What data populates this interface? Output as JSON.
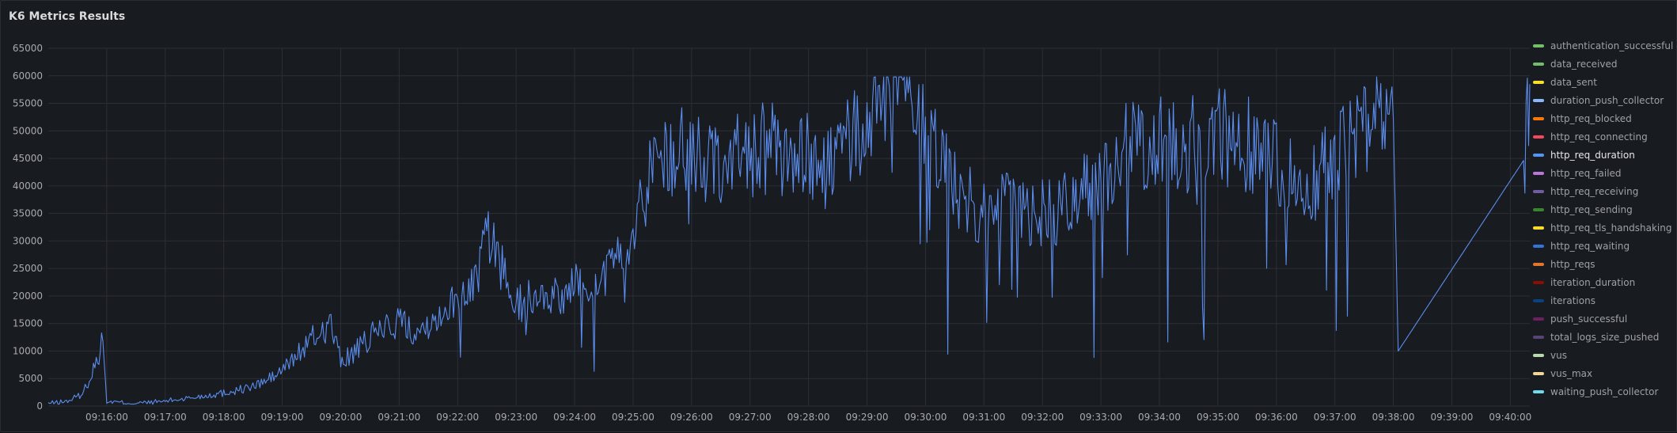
{
  "panel": {
    "title": "K6 Metrics Results"
  },
  "chart_data": {
    "type": "line",
    "title": "K6 Metrics Results",
    "ylim": [
      0,
      65000
    ],
    "y_ticks": [
      "0",
      "5000",
      "10000",
      "15000",
      "20000",
      "25000",
      "30000",
      "35000",
      "40000",
      "45000",
      "50000",
      "55000",
      "60000",
      "65000"
    ],
    "x_range": [
      "09:15:00",
      "09:40:20"
    ],
    "x_ticks": [
      "09:16:00",
      "09:17:00",
      "09:18:00",
      "09:19:00",
      "09:20:00",
      "09:21:00",
      "09:22:00",
      "09:23:00",
      "09:24:00",
      "09:25:00",
      "09:26:00",
      "09:27:00",
      "09:28:00",
      "09:29:00",
      "09:30:00",
      "09:31:00",
      "09:32:00",
      "09:33:00",
      "09:34:00",
      "09:35:00",
      "09:36:00",
      "09:37:00",
      "09:38:00",
      "09:39:00",
      "09:40:00"
    ],
    "grid": true,
    "legend_position": "right",
    "series": [
      {
        "name": "http_req_duration",
        "color": "#5b8def",
        "points": [
          [
            "09:15:00",
            500
          ],
          [
            "09:15:20",
            900
          ],
          [
            "09:15:35",
            2200
          ],
          [
            "09:15:45",
            6000
          ],
          [
            "09:15:52",
            9500
          ],
          [
            "09:15:56",
            11800
          ],
          [
            "09:16:00",
            800
          ],
          [
            "09:16:30",
            500
          ],
          [
            "09:17:00",
            900
          ],
          [
            "09:17:30",
            1600
          ],
          [
            "09:18:00",
            2400
          ],
          [
            "09:18:30",
            3500
          ],
          [
            "09:18:50",
            5200
          ],
          [
            "09:19:00",
            6500
          ],
          [
            "09:19:30",
            12000
          ],
          [
            "09:19:50",
            15000
          ],
          [
            "09:20:00",
            8000
          ],
          [
            "09:20:20",
            10500
          ],
          [
            "09:20:40",
            14000
          ],
          [
            "09:21:00",
            15500
          ],
          [
            "09:21:20",
            13500
          ],
          [
            "09:21:40",
            17000
          ],
          [
            "09:22:00",
            19500
          ],
          [
            "09:22:20",
            23500
          ],
          [
            "09:22:30",
            31000
          ],
          [
            "09:22:40",
            28000
          ],
          [
            "09:23:00",
            18000
          ],
          [
            "09:23:20",
            21000
          ],
          [
            "09:23:40",
            19500
          ],
          [
            "09:24:00",
            22000
          ],
          [
            "09:24:20",
            23000
          ],
          [
            "09:24:40",
            24500
          ],
          [
            "09:25:00",
            32000
          ],
          [
            "09:25:20",
            44000
          ],
          [
            "09:25:40",
            46500
          ],
          [
            "09:26:00",
            45000
          ],
          [
            "09:26:20",
            45500
          ],
          [
            "09:26:40",
            44000
          ],
          [
            "09:27:00",
            46500
          ],
          [
            "09:27:20",
            47000
          ],
          [
            "09:27:40",
            44500
          ],
          [
            "09:28:00",
            45000
          ],
          [
            "09:28:20",
            43000
          ],
          [
            "09:28:40",
            47000
          ],
          [
            "09:29:00",
            52000
          ],
          [
            "09:29:20",
            56000
          ],
          [
            "09:29:30",
            59500
          ],
          [
            "09:29:45",
            59800
          ],
          [
            "09:30:00",
            52000
          ],
          [
            "09:30:20",
            44000
          ],
          [
            "09:30:40",
            37000
          ],
          [
            "09:31:00",
            36500
          ],
          [
            "09:31:20",
            37500
          ],
          [
            "09:31:40",
            34500
          ],
          [
            "09:32:00",
            35000
          ],
          [
            "09:32:20",
            35500
          ],
          [
            "09:32:40",
            38500
          ],
          [
            "09:33:00",
            42000
          ],
          [
            "09:33:20",
            46000
          ],
          [
            "09:33:40",
            47500
          ],
          [
            "09:34:00",
            48500
          ],
          [
            "09:34:20",
            47000
          ],
          [
            "09:34:40",
            48000
          ],
          [
            "09:35:00",
            49000
          ],
          [
            "09:35:20",
            48500
          ],
          [
            "09:35:40",
            46500
          ],
          [
            "09:36:00",
            44000
          ],
          [
            "09:36:20",
            42500
          ],
          [
            "09:36:40",
            41500
          ],
          [
            "09:37:00",
            45000
          ],
          [
            "09:37:20",
            49000
          ],
          [
            "09:37:40",
            51000
          ],
          [
            "09:38:00",
            52000
          ],
          [
            "09:38:05",
            10000
          ],
          [
            "09:40:15",
            45000
          ],
          [
            "09:40:20",
            58500
          ]
        ]
      }
    ]
  },
  "legend": [
    {
      "label": "authentication_successful",
      "color": "#73bf69"
    },
    {
      "label": "data_received",
      "color": "#73bf69"
    },
    {
      "label": "data_sent",
      "color": "#fade2a"
    },
    {
      "label": "duration_push_collector",
      "color": "#8ab8ff"
    },
    {
      "label": "http_req_blocked",
      "color": "#ff780a"
    },
    {
      "label": "http_req_connecting",
      "color": "#f2495c"
    },
    {
      "label": "http_req_duration",
      "color": "#5794f2",
      "active": true
    },
    {
      "label": "http_req_failed",
      "color": "#b877d9"
    },
    {
      "label": "http_req_receiving",
      "color": "#705da0"
    },
    {
      "label": "http_req_sending",
      "color": "#37872d"
    },
    {
      "label": "http_req_tls_handshaking",
      "color": "#fade2a"
    },
    {
      "label": "http_req_waiting",
      "color": "#3274d9"
    },
    {
      "label": "http_reqs",
      "color": "#e0752d"
    },
    {
      "label": "iteration_duration",
      "color": "#890f02"
    },
    {
      "label": "iterations",
      "color": "#0a437c"
    },
    {
      "label": "push_successful",
      "color": "#6d1f62"
    },
    {
      "label": "total_logs_size_pushed",
      "color": "#584477"
    },
    {
      "label": "vus",
      "color": "#b7dbab"
    },
    {
      "label": "vus_max",
      "color": "#f4d598"
    },
    {
      "label": "waiting_push_collector",
      "color": "#70dbed"
    }
  ]
}
